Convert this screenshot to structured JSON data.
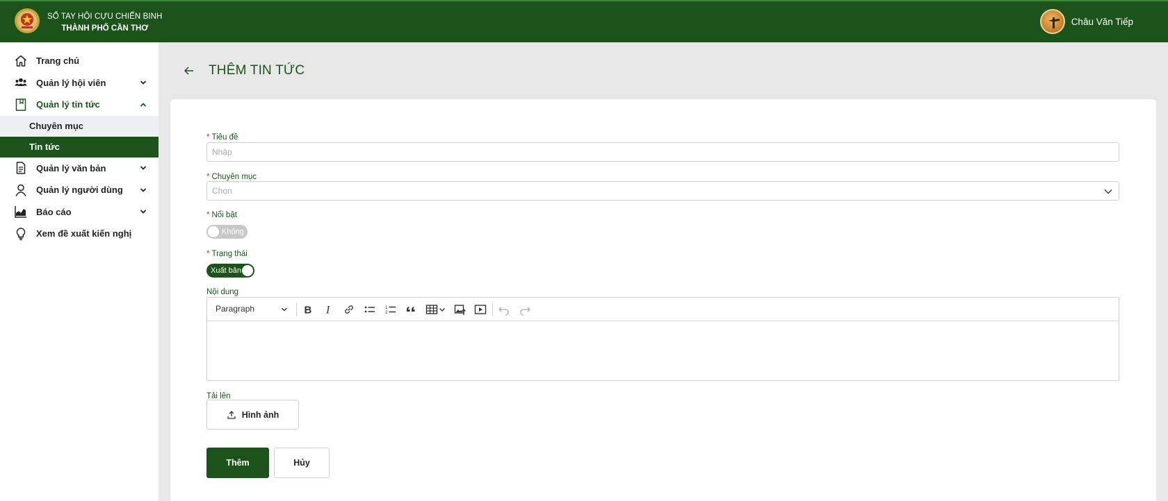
{
  "header": {
    "brand_line1": "SỔ TAY HỘI CỰU CHIẾN BINH",
    "brand_line2": "THÀNH PHỐ CẦN THƠ",
    "user_name": "Châu Văn Tiếp"
  },
  "sidebar": {
    "items": [
      {
        "label": "Trang chủ",
        "icon": "home-icon"
      },
      {
        "label": "Quản lý hội viên",
        "icon": "users-icon"
      },
      {
        "label": "Quản lý tin tức",
        "icon": "news-icon"
      },
      {
        "label": "Quản lý văn bản",
        "icon": "document-icon"
      },
      {
        "label": "Quản lý người dùng",
        "icon": "user-icon"
      },
      {
        "label": "Báo cáo",
        "icon": "chart-icon"
      },
      {
        "label": "Xem đề xuất kiến nghị",
        "icon": "lightbulb-icon"
      }
    ],
    "sub_items": [
      {
        "label": "Chuyên mục"
      },
      {
        "label": "Tin tức"
      }
    ]
  },
  "page": {
    "title": "THÊM TIN TỨC"
  },
  "form": {
    "title_label": "Tiêu đề",
    "title_placeholder": "Nhập",
    "category_label": "Chuyên mục",
    "category_placeholder": "Chọn",
    "featured_label": "Nổi bật",
    "featured_value": "Không",
    "status_label": "Trạng thái",
    "status_value": "Xuất bản",
    "content_label": "Nội dung",
    "paragraph_select": "Paragraph",
    "upload_label": "Tải lên",
    "upload_button": "Hình ảnh",
    "submit_button": "Thêm",
    "cancel_button": "Hủy"
  },
  "colors": {
    "primary": "#1b531b",
    "required": "#dd3333"
  }
}
